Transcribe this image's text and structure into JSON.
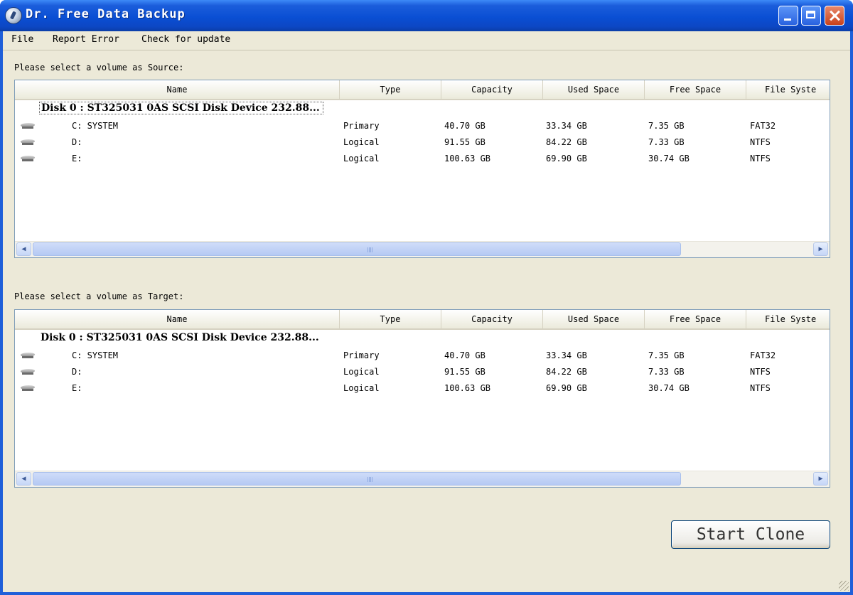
{
  "window": {
    "title": "Dr. Free Data Backup"
  },
  "menu": {
    "items": [
      "File",
      "Report Error",
      "Check for update"
    ]
  },
  "source": {
    "label": "Please select a volume as Source:",
    "columns": [
      "Name",
      "Type",
      "Capacity",
      "Used Space",
      "Free Space",
      "File Syste"
    ],
    "disk": "Disk 0 : ST325031 0AS SCSI Disk Device  232.88...",
    "volumes": [
      {
        "name": "C: SYSTEM",
        "type": "Primary",
        "capacity": "40.70 GB",
        "used": "33.34 GB",
        "free": "7.35 GB",
        "fs": "FAT32"
      },
      {
        "name": "D:",
        "type": "Logical",
        "capacity": "91.55 GB",
        "used": "84.22 GB",
        "free": "7.33 GB",
        "fs": "NTFS"
      },
      {
        "name": "E:",
        "type": "Logical",
        "capacity": "100.63 GB",
        "used": "69.90 GB",
        "free": "30.74 GB",
        "fs": "NTFS"
      }
    ]
  },
  "target": {
    "label": "Please select a volume as Target:",
    "columns": [
      "Name",
      "Type",
      "Capacity",
      "Used Space",
      "Free Space",
      "File Syste"
    ],
    "disk": "Disk 0 : ST325031 0AS SCSI Disk Device  232.88...",
    "volumes": [
      {
        "name": "C: SYSTEM",
        "type": "Primary",
        "capacity": "40.70 GB",
        "used": "33.34 GB",
        "free": "7.35 GB",
        "fs": "FAT32"
      },
      {
        "name": "D:",
        "type": "Logical",
        "capacity": "91.55 GB",
        "used": "84.22 GB",
        "free": "7.33 GB",
        "fs": "NTFS"
      },
      {
        "name": "E:",
        "type": "Logical",
        "capacity": "100.63 GB",
        "used": "69.90 GB",
        "free": "30.74 GB",
        "fs": "NTFS"
      }
    ]
  },
  "actions": {
    "start_clone": "Start Clone"
  },
  "icons": {
    "app": "globe-disk-icon",
    "minimize": "minimize-icon",
    "maximize": "maximize-icon",
    "close": "close-icon",
    "volume": "hard-drive-icon",
    "scroll_left": "chevron-left-icon",
    "scroll_right": "chevron-right-icon"
  }
}
